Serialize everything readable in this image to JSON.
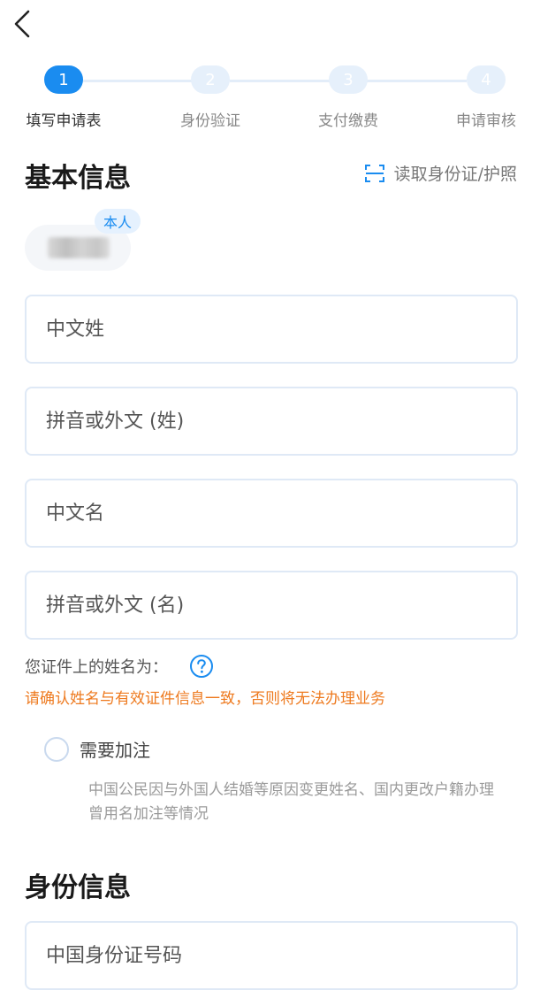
{
  "nav": {
    "back_icon": "chevron-left-icon"
  },
  "stepper": {
    "steps": [
      {
        "number": "1",
        "label": "填写申请表",
        "active": true
      },
      {
        "number": "2",
        "label": "身份验证",
        "active": false
      },
      {
        "number": "3",
        "label": "支付缴费",
        "active": false
      },
      {
        "number": "4",
        "label": "申请审核",
        "active": false
      }
    ]
  },
  "basic_info": {
    "title": "基本信息",
    "scan_label": "读取身份证/护照",
    "scan_icon": "scan-icon",
    "self_badge": "本人"
  },
  "fields": {
    "cn_surname": {
      "placeholder": "中文姓",
      "value": ""
    },
    "foreign_surname": {
      "placeholder": "拼音或外文 (姓)",
      "value": ""
    },
    "cn_given_name": {
      "placeholder": "中文名",
      "value": ""
    },
    "foreign_given_name": {
      "placeholder": "拼音或外文 (名)",
      "value": ""
    }
  },
  "name_hint": "您证件上的姓名为：",
  "help_icon": "question-circle-icon",
  "warning": "请确认姓名与有效证件信息一致，否则将无法办理业务",
  "annotation": {
    "label": "需要加注",
    "checked": false,
    "note": "中国公民因与外国人结婚等原因变更姓名、国内更改户籍办理曾用名加注等情况"
  },
  "id_info": {
    "title": "身份信息",
    "id_number_placeholder": "中国身份证号码"
  },
  "colors": {
    "accent": "#1a8cf0",
    "warning": "#ee7a1f",
    "border": "#dfe9f6"
  }
}
